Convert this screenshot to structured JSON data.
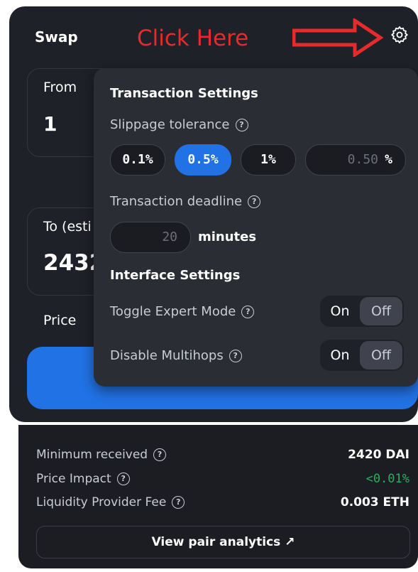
{
  "header": {
    "title": "Swap",
    "annotation": "Click Here"
  },
  "from": {
    "label": "From",
    "value": "1"
  },
  "to": {
    "label": "To (esti",
    "value": "2432"
  },
  "price": {
    "label": "Price"
  },
  "settings": {
    "transaction_header": "Transaction Settings",
    "slippage_label": "Slippage tolerance",
    "slippage_options": [
      "0.1%",
      "0.5%",
      "1%"
    ],
    "slippage_selected": "0.5%",
    "slippage_custom_value": "0.50",
    "slippage_custom_unit": "%",
    "deadline_label": "Transaction deadline",
    "deadline_value": "20",
    "deadline_unit": "minutes",
    "interface_header": "Interface Settings",
    "expert_mode_label": "Toggle Expert Mode",
    "multihops_label": "Disable Multihops",
    "toggle_on": "On",
    "toggle_off": "Off"
  },
  "details": {
    "min_received_label": "Minimum received",
    "min_received_value": "2420 DAI",
    "price_impact_label": "Price Impact",
    "price_impact_value": "<0.01%",
    "lp_fee_label": "Liquidity Provider Fee",
    "lp_fee_value": "0.003 ETH",
    "analytics_label": "View pair analytics ↗"
  },
  "help_glyph": "?",
  "colors": {
    "accent": "#2172e5",
    "annotation": "#e52b2b",
    "positive": "#27ae60",
    "panel": "#1f2128"
  }
}
